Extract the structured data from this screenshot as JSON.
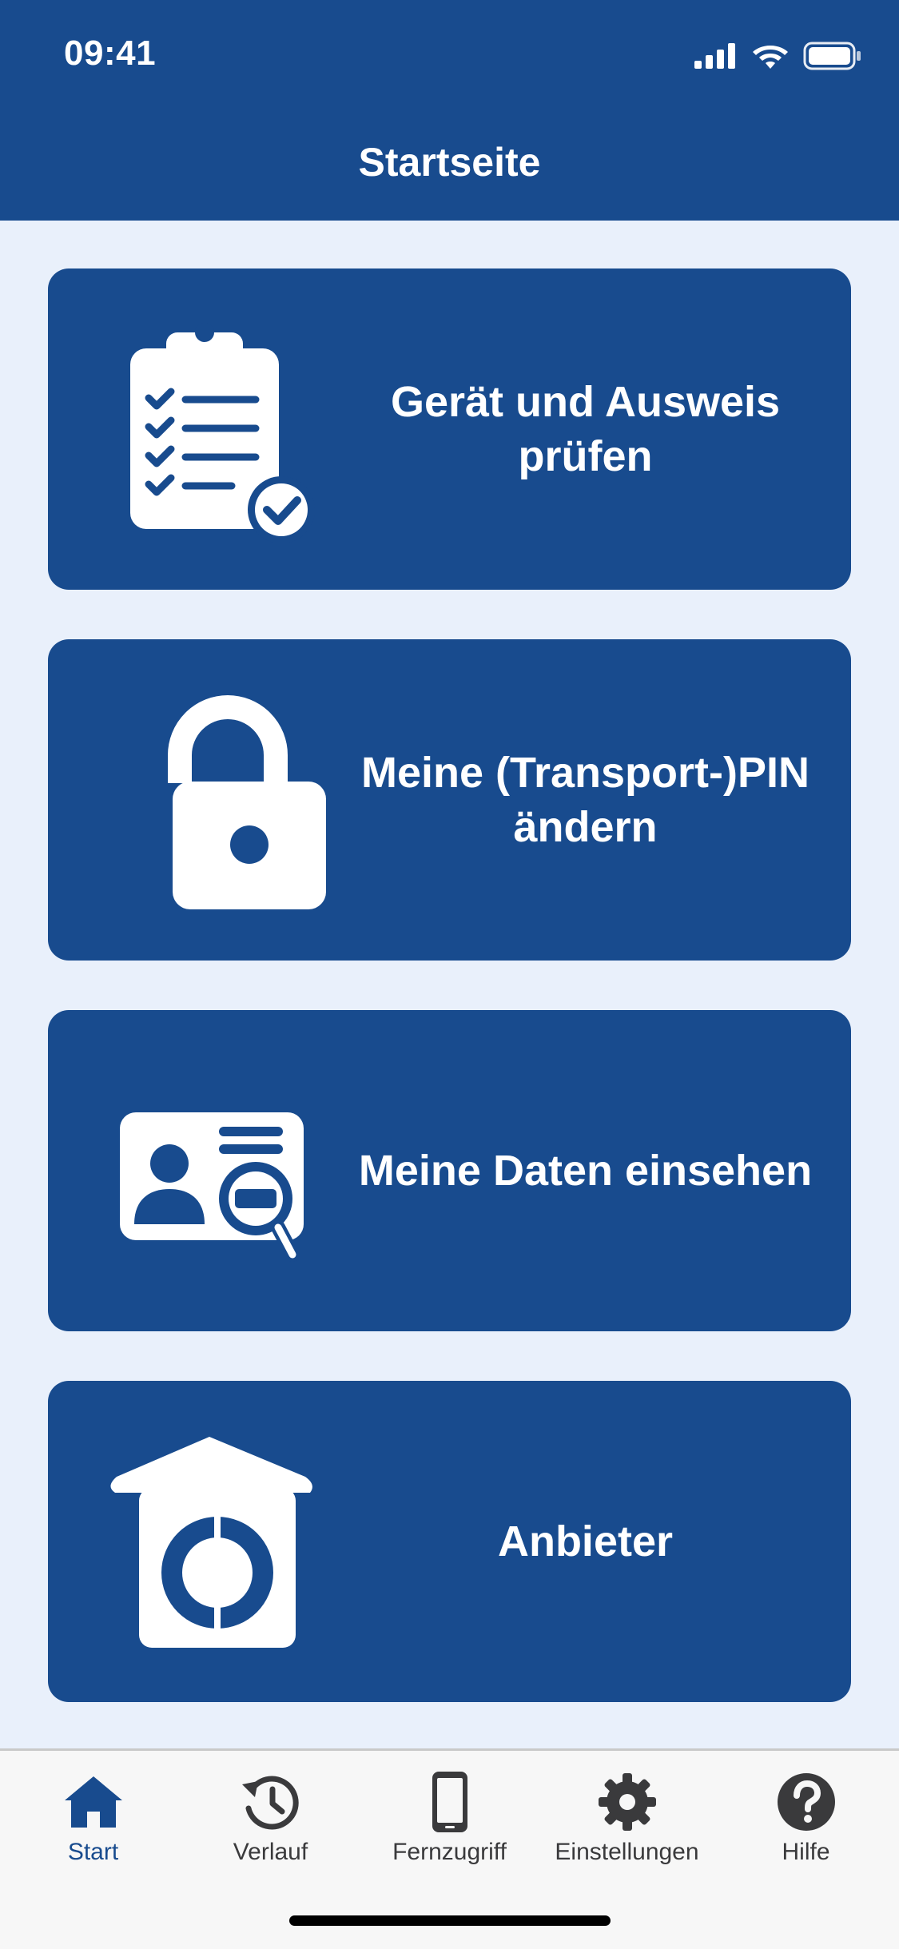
{
  "status_bar": {
    "time": "09:41",
    "icons": [
      "signal-icon",
      "wifi-icon",
      "battery-icon"
    ]
  },
  "header": {
    "title": "Startseite"
  },
  "tiles": [
    {
      "label": "Gerät und Ausweis\nprüfen",
      "icon": "clipboard-check-icon"
    },
    {
      "label": "Meine (Transport-)PIN\nändern",
      "icon": "lock-icon"
    },
    {
      "label": "Meine Daten einsehen",
      "icon": "id-card-search-icon"
    },
    {
      "label": "Anbieter",
      "icon": "provider-house-icon"
    }
  ],
  "tabbar": {
    "items": [
      {
        "label": "Start",
        "icon": "home-icon",
        "active": true
      },
      {
        "label": "Verlauf",
        "icon": "history-icon",
        "active": false
      },
      {
        "label": "Fernzugriff",
        "icon": "phone-icon",
        "active": false
      },
      {
        "label": "Einstellungen",
        "icon": "gear-icon",
        "active": false
      },
      {
        "label": "Hilfe",
        "icon": "help-icon",
        "active": false
      }
    ]
  },
  "colors": {
    "primary": "#184b8e",
    "background": "#e9f0fb",
    "tabbar_background": "#f7f7f7",
    "tab_inactive": "#3a3a3c"
  }
}
